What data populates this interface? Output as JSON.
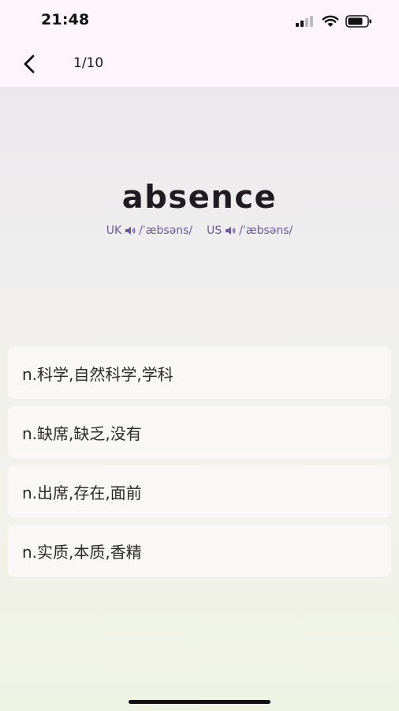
{
  "status_bar": {
    "time": "21:48"
  },
  "nav": {
    "progress": "1/10"
  },
  "word": {
    "text": "absence",
    "uk_label": "UK",
    "uk_phonetic": "/ˈæbsəns/",
    "us_label": "US",
    "us_phonetic": "/ˈæbsəns/"
  },
  "options": [
    "n.科学,自然科学,学科",
    "n.缺席,缺乏,没有",
    "n.出席,存在,面前",
    "n.实质,本质,香精"
  ],
  "icons": {
    "back": "chevron-left-icon",
    "speaker": "speaker-icon",
    "signal": "cellular-signal-icon",
    "wifi": "wifi-icon",
    "battery": "battery-icon"
  },
  "colors": {
    "phonetic": "#6a5a9a",
    "header_bg": "#fcf5fc"
  }
}
